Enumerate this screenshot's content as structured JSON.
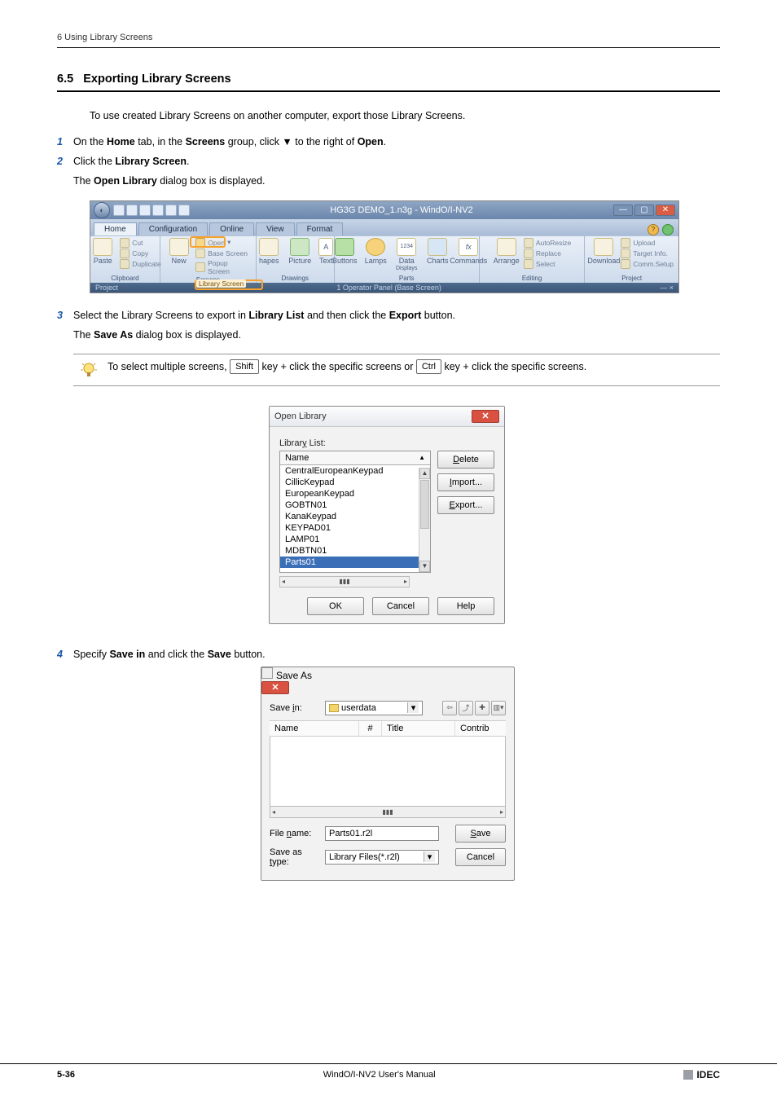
{
  "header": {
    "chapter": "6 Using Library Screens"
  },
  "section": {
    "number": "6.5",
    "title": "Exporting Library Screens"
  },
  "intro": "To use created Library Screens on another computer, export those Library Screens.",
  "steps": {
    "s1": {
      "num": "1",
      "plain1": "On the ",
      "b1": "Home",
      "plain2": " tab, in the ",
      "b2": "Screens",
      "plain3": " group, click ▼ to the right of ",
      "b3": "Open",
      "plain4": "."
    },
    "s2": {
      "num": "2",
      "plain1": "Click the ",
      "b1": "Library Screen",
      "plain2": "."
    },
    "s2sub": {
      "plain1": "The ",
      "b1": "Open Library",
      "plain2": " dialog box is displayed."
    },
    "s3": {
      "num": "3",
      "plain1": "Select the Library Screens to export in ",
      "b1": "Library List",
      "plain2": " and then click the ",
      "b2": "Export",
      "plain3": " button."
    },
    "s3sub": {
      "plain1": "The ",
      "b1": "Save As",
      "plain2": " dialog box is displayed."
    },
    "s4": {
      "num": "4",
      "plain1": "Specify ",
      "b1": "Save in",
      "plain2": " and click the ",
      "b2": "Save",
      "plain3": " button."
    }
  },
  "tip": {
    "t1": "To select multiple screens, ",
    "k1": "Shift",
    "t2": " key + click the specific screens or ",
    "k2": "Ctrl",
    "t3": " key + click the specific screens."
  },
  "ribbon": {
    "title": "HG3G DEMO_1.n3g - WindO/I-NV2",
    "tabs": {
      "home": "Home",
      "config": "Configuration",
      "online": "Online",
      "view": "View",
      "format": "Format"
    },
    "groups": {
      "clipboard": {
        "label": "Clipboard",
        "cut": "Cut",
        "copy": "Copy",
        "paste": "Paste",
        "dup": "Duplicate"
      },
      "screens": {
        "label": "Screens",
        "new": "New",
        "open": "Open",
        "base": "Base Screen",
        "popup": "Popup Screen",
        "library": "Library Screen"
      },
      "drawings": {
        "label": "Drawings",
        "shapes": "hapes",
        "picture": "Picture",
        "text": "Text",
        "a": "A"
      },
      "parts": {
        "label": "Parts",
        "buttons": "Buttons",
        "lamps": "Lamps",
        "data": "Data",
        "displays": "Displays",
        "charts": "Charts",
        "commands": "Commands",
        "d1234": "1234",
        "fx": "fx"
      },
      "editing": {
        "label": "Editing",
        "arrange": "Arrange",
        "autoresize": "AutoResize",
        "replace": "Replace",
        "select": "Select"
      },
      "project": {
        "label": "Project",
        "download": "Download",
        "upload": "Upload",
        "target": "Target Info.",
        "comm": "Comm.Setup"
      }
    },
    "status": {
      "left": "Project",
      "mid": "1 Operator Panel (Base Screen)"
    }
  },
  "openLibrary": {
    "title": "Open Library",
    "listLabel": "Library List:",
    "header": "Name",
    "items": {
      "i0": "CentralEuropeanKeypad",
      "i1": "CillicKeypad",
      "i2": "EuropeanKeypad",
      "i3": "GOBTN01",
      "i4": "KanaKeypad",
      "i5": "KEYPAD01",
      "i6": "LAMP01",
      "i7": "MDBTN01",
      "sel": "Parts01"
    },
    "buttons": {
      "delete": "Delete",
      "import": "Import...",
      "export": "Export...",
      "ok": "OK",
      "cancel": "Cancel",
      "help": "Help"
    }
  },
  "saveAs": {
    "title": "Save As",
    "saveInLabel": "Save in:",
    "folder": "userdata",
    "colName": "Name",
    "colHash": "#",
    "colTitle": "Title",
    "colContrib": "Contrib",
    "fileNameLabel": "File name:",
    "fileName": "Parts01.r2l",
    "saveTypeLabel": "Save as type:",
    "saveType": "Library Files(*.r2l)",
    "save": "Save",
    "cancel": "Cancel"
  },
  "footer": {
    "page": "5-36",
    "manual": "WindO/I-NV2 User's Manual",
    "brand": "IDEC"
  }
}
